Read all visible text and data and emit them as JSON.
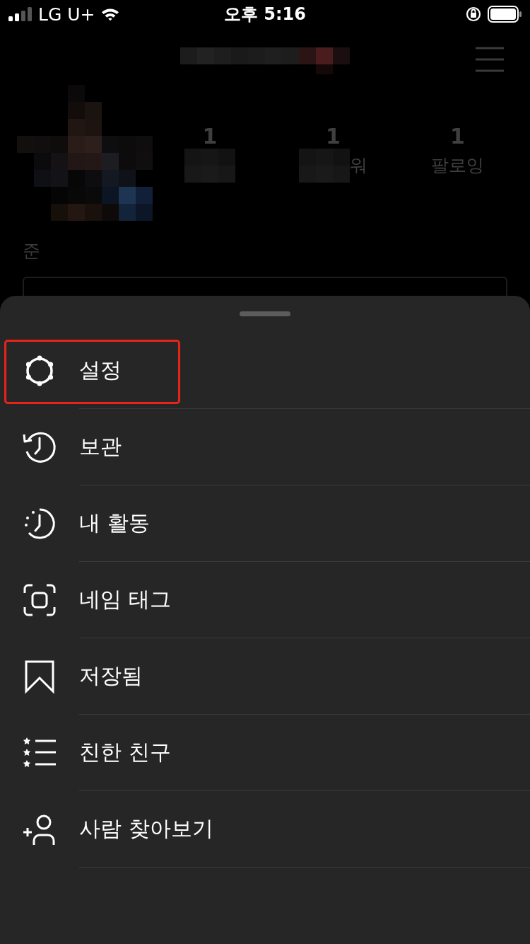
{
  "status_bar": {
    "carrier": "LG U+",
    "time": "오후 5:16"
  },
  "profile": {
    "stats": [
      {
        "value": "1"
      },
      {
        "value": "1",
        "label": "워"
      },
      {
        "value": "1",
        "label": "팔로잉"
      }
    ],
    "name": "준"
  },
  "menu": {
    "items": [
      {
        "label": "설정",
        "highlighted": true
      },
      {
        "label": "보관",
        "highlighted": false
      },
      {
        "label": "내 활동",
        "highlighted": false
      },
      {
        "label": "네임 태그",
        "highlighted": false
      },
      {
        "label": "저장됨",
        "highlighted": false
      },
      {
        "label": "친한 친구",
        "highlighted": false
      },
      {
        "label": "사람 찾아보기",
        "highlighted": false
      }
    ]
  }
}
